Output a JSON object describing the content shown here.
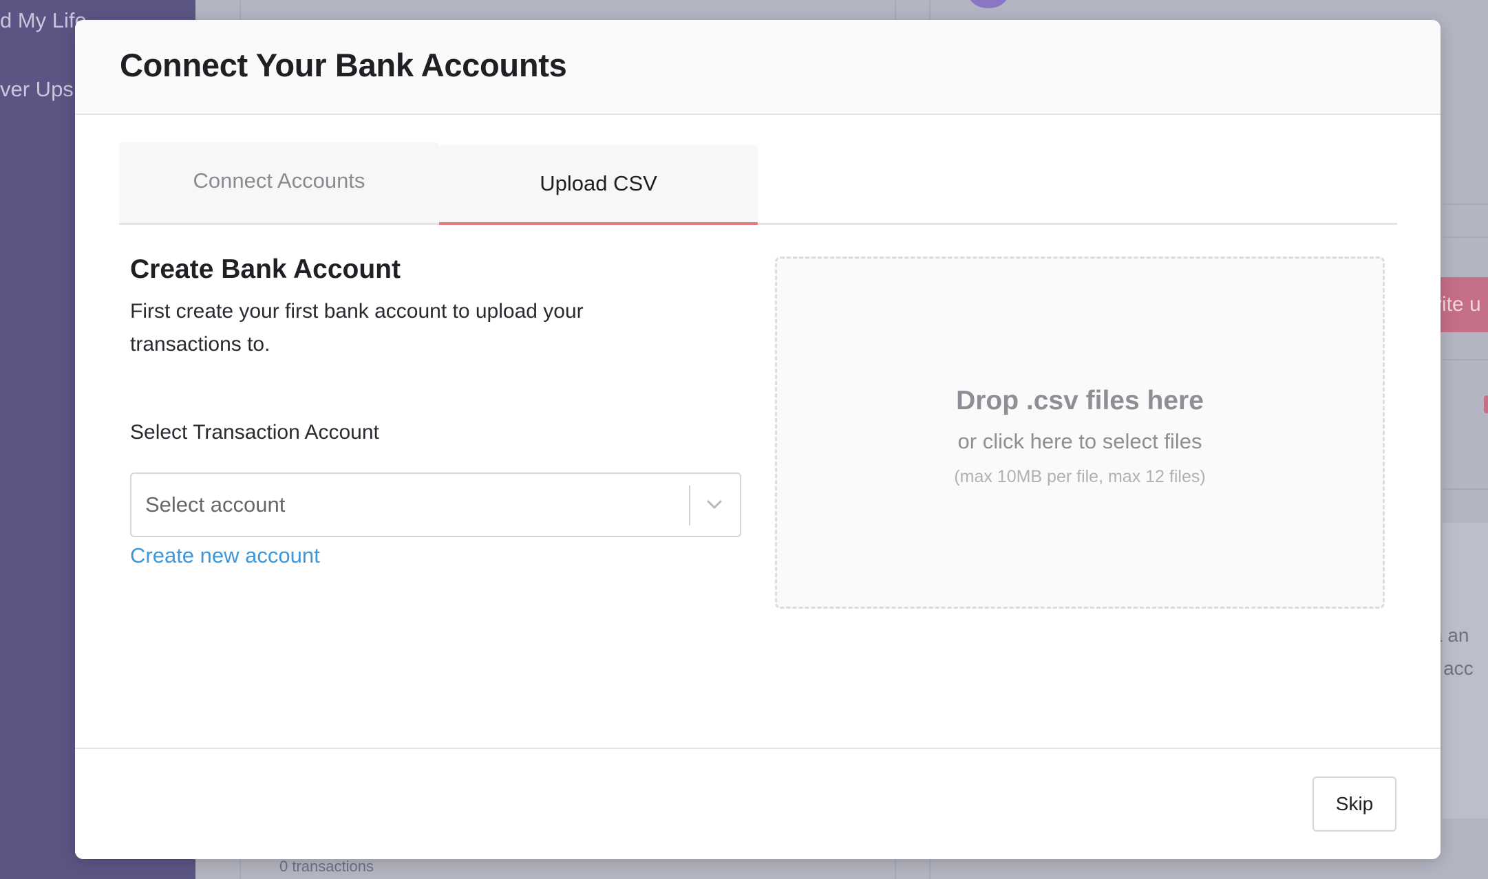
{
  "background": {
    "sidebar_items": [
      "d My Life",
      "ver Ups"
    ],
    "footer_text": "0 transactions",
    "right_button_fragment": "vite u",
    "right_text_fragments": [
      "a an",
      "r acc"
    ]
  },
  "modal": {
    "title": "Connect Your Bank Accounts",
    "tabs": [
      {
        "label": "Connect Accounts",
        "active": false
      },
      {
        "label": "Upload CSV",
        "active": true
      }
    ],
    "create_account": {
      "title": "Create Bank Account",
      "description": "First create your first bank account to upload your transactions to.",
      "select_label": "Select Transaction Account",
      "select_placeholder": "Select account",
      "create_link": "Create new account"
    },
    "dropzone": {
      "title": "Drop .csv files here",
      "subtitle": "or click here to select files",
      "hint": "(max 10MB per file, max 12 files)"
    },
    "footer": {
      "skip_label": "Skip"
    }
  },
  "colors": {
    "accent_tab_underline": "#e67b86",
    "link": "#3c98db",
    "sidebar_bg": "#5b5584"
  }
}
